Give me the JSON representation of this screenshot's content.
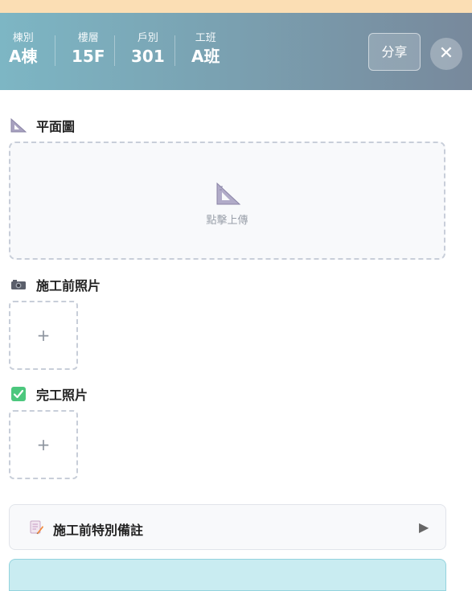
{
  "header": {
    "fields": [
      {
        "label": "棟別",
        "value": "A棟"
      },
      {
        "label": "樓層",
        "value": "15F"
      },
      {
        "label": "戶別",
        "value": "301"
      },
      {
        "label": "工班",
        "value": "A班"
      }
    ],
    "share_label": "分享",
    "close_label": "✕"
  },
  "floor_plan": {
    "title": "平面圖",
    "icon": "triangle-ruler-icon",
    "upload_hint": "點擊上傳"
  },
  "before_photos": {
    "title": "施工前照片",
    "icon": "camera-icon",
    "add_label": "+"
  },
  "after_photos": {
    "title": "完工照片",
    "icon": "check-box-icon",
    "add_label": "+"
  },
  "notes": {
    "label": "施工前特別備註",
    "icon": "memo-icon",
    "expand_icon": "play-arrow-icon",
    "arrow": "▶"
  },
  "colors": {
    "header_start": "#7db6c4",
    "header_end": "#78899c",
    "top_strip": "#fbdeb4",
    "check_green": "#4cc77d",
    "bottom_panel": "#c9ecf1"
  }
}
